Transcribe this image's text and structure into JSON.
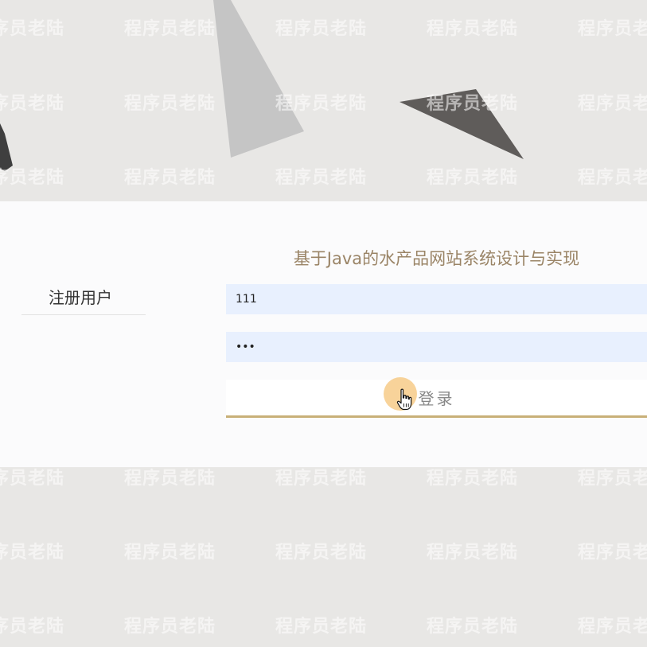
{
  "login": {
    "title": "基于Java的水产品网站系统设计与实现",
    "register_label": "注册用户",
    "username_value": "111",
    "password_value": "111",
    "submit_label": "登录"
  },
  "watermark": {
    "text": "程序员老陆"
  },
  "colors": {
    "background": "#e8e7e5",
    "panel": "#fbfbfc",
    "title": "#9a8466",
    "input_fill": "#e8f0fe",
    "button_underline": "#c8b078",
    "click_ripple": "#f6c478"
  },
  "icons": {
    "cursor": "hand-pointer-icon"
  }
}
